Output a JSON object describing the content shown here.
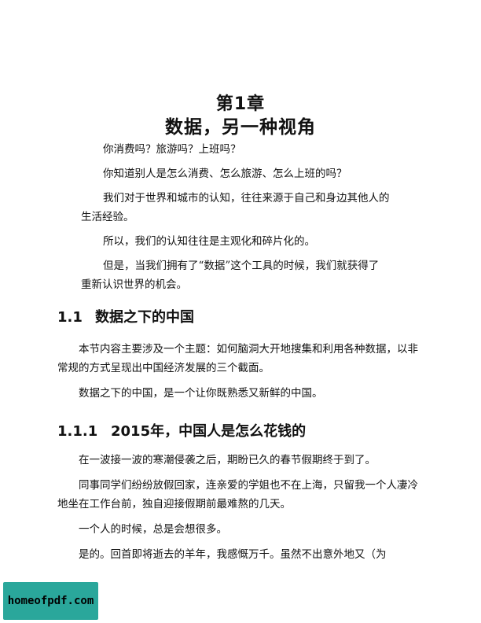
{
  "chapter": {
    "number_label": "第1章",
    "title": "数据，另一种视角"
  },
  "intro": [
    "你消费吗？旅游吗？上班吗？",
    "你知道别人是怎么消费、怎么旅游、怎么上班的吗？",
    "我们对于世界和城市的认知，往往来源于自己和身边其他人的",
    "生活经验。",
    "所以，我们的认知往往是主观化和碎片化的。",
    "但是，当我们拥有了“数据”这个工具的时候，我们就获得了",
    "重新认识世界的机会。"
  ],
  "section_1_1": {
    "number": "1.1",
    "title": "数据之下的中国",
    "paragraphs": [
      "本节内容主要涉及一个主题：如何脑洞大开地搜集和利用各种数据，以非常规的方式呈现出中国经济发展的三个截面。",
      "数据之下的中国，是一个让你既熟悉又新鲜的中国。"
    ]
  },
  "section_1_1_1": {
    "number": "1.1.1",
    "title": "2015年，中国人是怎么花钱的",
    "paragraphs": [
      "在一波接一波的寒潮侵袭之后，期盼已久的春节假期终于到了。",
      "同事同学们纷纷放假回家，连亲爱的学姐也不在上海，只留我一个人凄冷地坐在工作台前，独自迎接假期前最难熬的几天。",
      "一个人的时候，总是会想很多。",
      "是的。回首即将逝去的羊年，我感慨万千。虽然不出意外地又（为"
    ]
  },
  "watermark": {
    "text": "homeofpdf.com",
    "color": "#2aa79b"
  }
}
